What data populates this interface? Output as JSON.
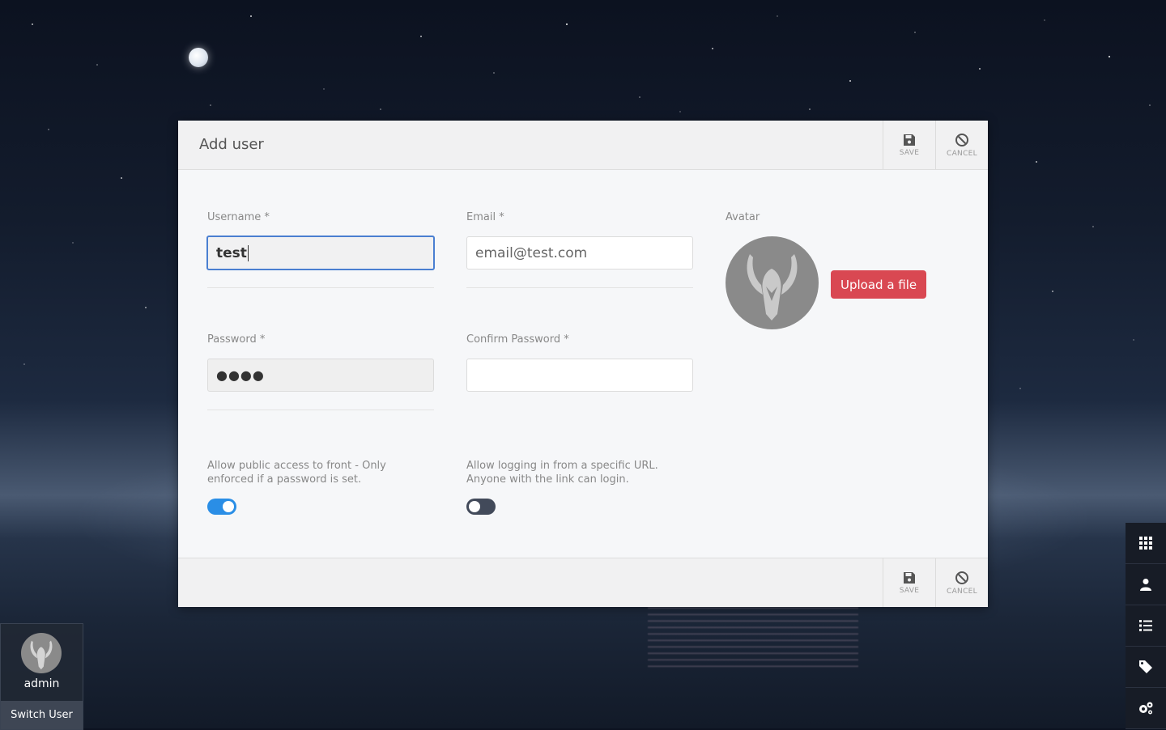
{
  "modal": {
    "title": "Add user",
    "header_actions": {
      "save_label": "SAVE",
      "cancel_label": "CANCEL"
    },
    "footer_actions": {
      "save_label": "SAVE",
      "cancel_label": "CANCEL"
    }
  },
  "form": {
    "username": {
      "label": "Username *",
      "value": "test"
    },
    "email": {
      "label": "Email *",
      "placeholder": "email@test.com"
    },
    "password": {
      "label": "Password *",
      "masked_value": "●●●●"
    },
    "confirm_password": {
      "label": "Confirm Password *",
      "value": ""
    },
    "avatar": {
      "label": "Avatar",
      "upload_label": "Upload a file",
      "upload_color": "#d94852"
    },
    "public_access": {
      "text": "Allow public access to front - Only enforced if a password is set.",
      "enabled": true
    },
    "url_login": {
      "text": "Allow logging in from a specific URL. Anyone with the link can login.",
      "enabled": false
    }
  },
  "user_panel": {
    "name": "admin",
    "switch_label": "Switch User"
  },
  "side_menu": {
    "items": [
      {
        "icon": "grid-icon"
      },
      {
        "icon": "user-icon"
      },
      {
        "icon": "list-icon"
      },
      {
        "icon": "tag-icon"
      },
      {
        "icon": "gears-icon"
      }
    ]
  },
  "colors": {
    "accent": "#2a8ee6",
    "focus_border": "#4a7fd1",
    "danger": "#d94852"
  }
}
